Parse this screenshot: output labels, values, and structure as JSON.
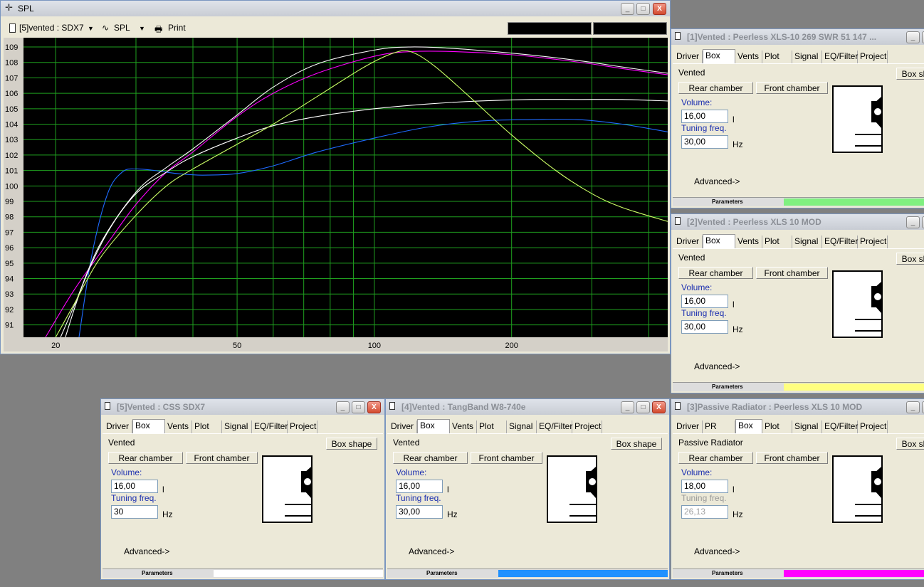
{
  "spl": {
    "title": "SPL",
    "driver_select": "[5]vented : SDX7",
    "plot_select": "SPL",
    "print_label": "Print",
    "buttons": {
      "minimize": "_",
      "maximize": "□",
      "close": "X"
    }
  },
  "chart_data": {
    "type": "line",
    "xscale": "log",
    "xlim": [
      17,
      440
    ],
    "ylim": [
      90.2,
      109.6
    ],
    "x_ticks": [
      20,
      50,
      100,
      200
    ],
    "y_ticks": [
      91,
      92,
      93,
      94,
      95,
      96,
      97,
      98,
      99,
      100,
      101,
      102,
      103,
      104,
      105,
      106,
      107,
      108,
      109
    ],
    "grid": true,
    "series": [
      {
        "color": "#1e6bff",
        "x": [
          22.5,
          24,
          26,
          28,
          30,
          33,
          37,
          42,
          50,
          60,
          75,
          100,
          130,
          170,
          220,
          280,
          350,
          440
        ],
        "y": [
          90.2,
          95.5,
          99.5,
          100.9,
          101.1,
          101.0,
          100.8,
          100.7,
          100.8,
          101.3,
          102.2,
          103.1,
          103.8,
          104.2,
          104.3,
          104.3,
          104.0,
          103.5
        ]
      },
      {
        "color": "#ff00ff",
        "x": [
          19,
          22,
          26,
          30,
          35,
          40,
          50,
          60,
          75,
          100,
          120,
          150,
          200,
          250,
          300,
          350,
          440
        ],
        "y": [
          90.2,
          93.3,
          96.3,
          98.8,
          100.9,
          102.2,
          104.5,
          106.0,
          107.3,
          108.4,
          108.7,
          108.7,
          108.5,
          108.2,
          107.9,
          107.6,
          107.2
        ]
      },
      {
        "color": "#f8f8f8",
        "x": [
          20.5,
          22,
          25,
          30,
          35,
          40,
          50,
          60,
          75,
          100,
          120,
          150,
          200,
          250,
          300,
          350,
          440
        ],
        "y": [
          90.2,
          92.3,
          96.2,
          99.6,
          101.2,
          102.4,
          104.6,
          106.4,
          107.9,
          108.8,
          109.0,
          108.9,
          108.6,
          108.3,
          108.0,
          107.7,
          107.3
        ]
      },
      {
        "color": "#ffffff",
        "x": [
          21,
          23,
          26,
          30,
          35,
          40,
          50,
          60,
          75,
          100,
          130,
          170,
          220,
          280,
          350,
          440
        ],
        "y": [
          90.2,
          93.7,
          97.0,
          99.5,
          100.9,
          101.9,
          103.1,
          103.9,
          104.5,
          105.0,
          105.3,
          105.5,
          105.6,
          105.6,
          105.6,
          105.5
        ]
      },
      {
        "color": "#ccff66",
        "x": [
          20,
          22,
          25,
          30,
          35,
          40,
          50,
          60,
          75,
          95,
          110,
          120,
          135,
          160,
          200,
          250,
          300,
          350,
          440
        ],
        "y": [
          90.2,
          92.4,
          95.3,
          98.1,
          100.0,
          101.1,
          102.7,
          104.0,
          105.8,
          107.7,
          108.6,
          108.7,
          107.8,
          105.9,
          103.3,
          101.0,
          99.5,
          98.6,
          97.7
        ]
      }
    ]
  },
  "windows": [
    {
      "title": "[1]Vented : Peerless XLS-10 269 SWR 51 147 ...",
      "tabs": [
        "Driver",
        "Box",
        "Vents",
        "Plot",
        "Signal",
        "EQ/Filter",
        "Project"
      ],
      "active_tab": "Box",
      "box_type": "Vented",
      "box_shape_label": "Box shape",
      "rear_chamber_label": "Rear chamber",
      "front_chamber_label": "Front chamber",
      "volume_label": "Volume:",
      "volume_value": "16,00",
      "volume_unit": "l",
      "tuning_label": "Tuning freq.",
      "tuning_value": "30,00",
      "tuning_unit": "Hz",
      "advanced_label": "Advanced->",
      "params_label": "Parameters",
      "color": "#80f080"
    },
    {
      "title": "[2]Vented : Peerless XLS 10 MOD",
      "tabs": [
        "Driver",
        "Box",
        "Vents",
        "Plot",
        "Signal",
        "EQ/Filter",
        "Project"
      ],
      "active_tab": "Box",
      "box_type": "Vented",
      "box_shape_label": "Box shape",
      "rear_chamber_label": "Rear chamber",
      "front_chamber_label": "Front chamber",
      "volume_label": "Volume:",
      "volume_value": "16,00",
      "volume_unit": "l",
      "tuning_label": "Tuning freq.",
      "tuning_value": "30,00",
      "tuning_unit": "Hz",
      "advanced_label": "Advanced->",
      "params_label": "Parameters",
      "color": "#ffff80"
    },
    {
      "title": "[5]Vented : CSS SDX7",
      "tabs": [
        "Driver",
        "Box",
        "Vents",
        "Plot",
        "Signal",
        "EQ/Filter",
        "Project"
      ],
      "active_tab": "Box",
      "box_type": "Vented",
      "box_shape_label": "Box shape",
      "rear_chamber_label": "Rear chamber",
      "front_chamber_label": "Front chamber",
      "volume_label": "Volume:",
      "volume_value": "16,00",
      "volume_unit": "l",
      "tuning_label": "Tuning freq.",
      "tuning_value": "30",
      "tuning_unit": "Hz",
      "advanced_label": "Advanced->",
      "params_label": "Parameters",
      "color": "#ffffff"
    },
    {
      "title": "[4]Vented : TangBand W8-740e",
      "tabs": [
        "Driver",
        "Box",
        "Vents",
        "Plot",
        "Signal",
        "EQ/Filter",
        "Project"
      ],
      "active_tab": "Box",
      "box_type": "Vented",
      "box_shape_label": "Box shape",
      "rear_chamber_label": "Rear chamber",
      "front_chamber_label": "Front chamber",
      "volume_label": "Volume:",
      "volume_value": "16,00",
      "volume_unit": "l",
      "tuning_label": "Tuning freq.",
      "tuning_value": "30,00",
      "tuning_unit": "Hz",
      "advanced_label": "Advanced->",
      "params_label": "Parameters",
      "color": "#1e90ff"
    },
    {
      "title": "[3]Passive Radiator : Peerless XLS 10 MOD",
      "tabs": [
        "Driver",
        "PR",
        "Box",
        "Plot",
        "Signal",
        "EQ/Filter",
        "Project"
      ],
      "active_tab": "Box",
      "box_type": "Passive Radiator",
      "box_shape_label": "Box shape",
      "rear_chamber_label": "Rear chamber",
      "front_chamber_label": "Front chamber",
      "volume_label": "Volume:",
      "volume_value": "18,00",
      "volume_unit": "l",
      "tuning_label": "Tuning freq.",
      "tuning_value": "26,13",
      "tuning_unit": "Hz",
      "advanced_label": "Advanced->",
      "params_label": "Parameters",
      "color": "#ff00ff"
    }
  ]
}
